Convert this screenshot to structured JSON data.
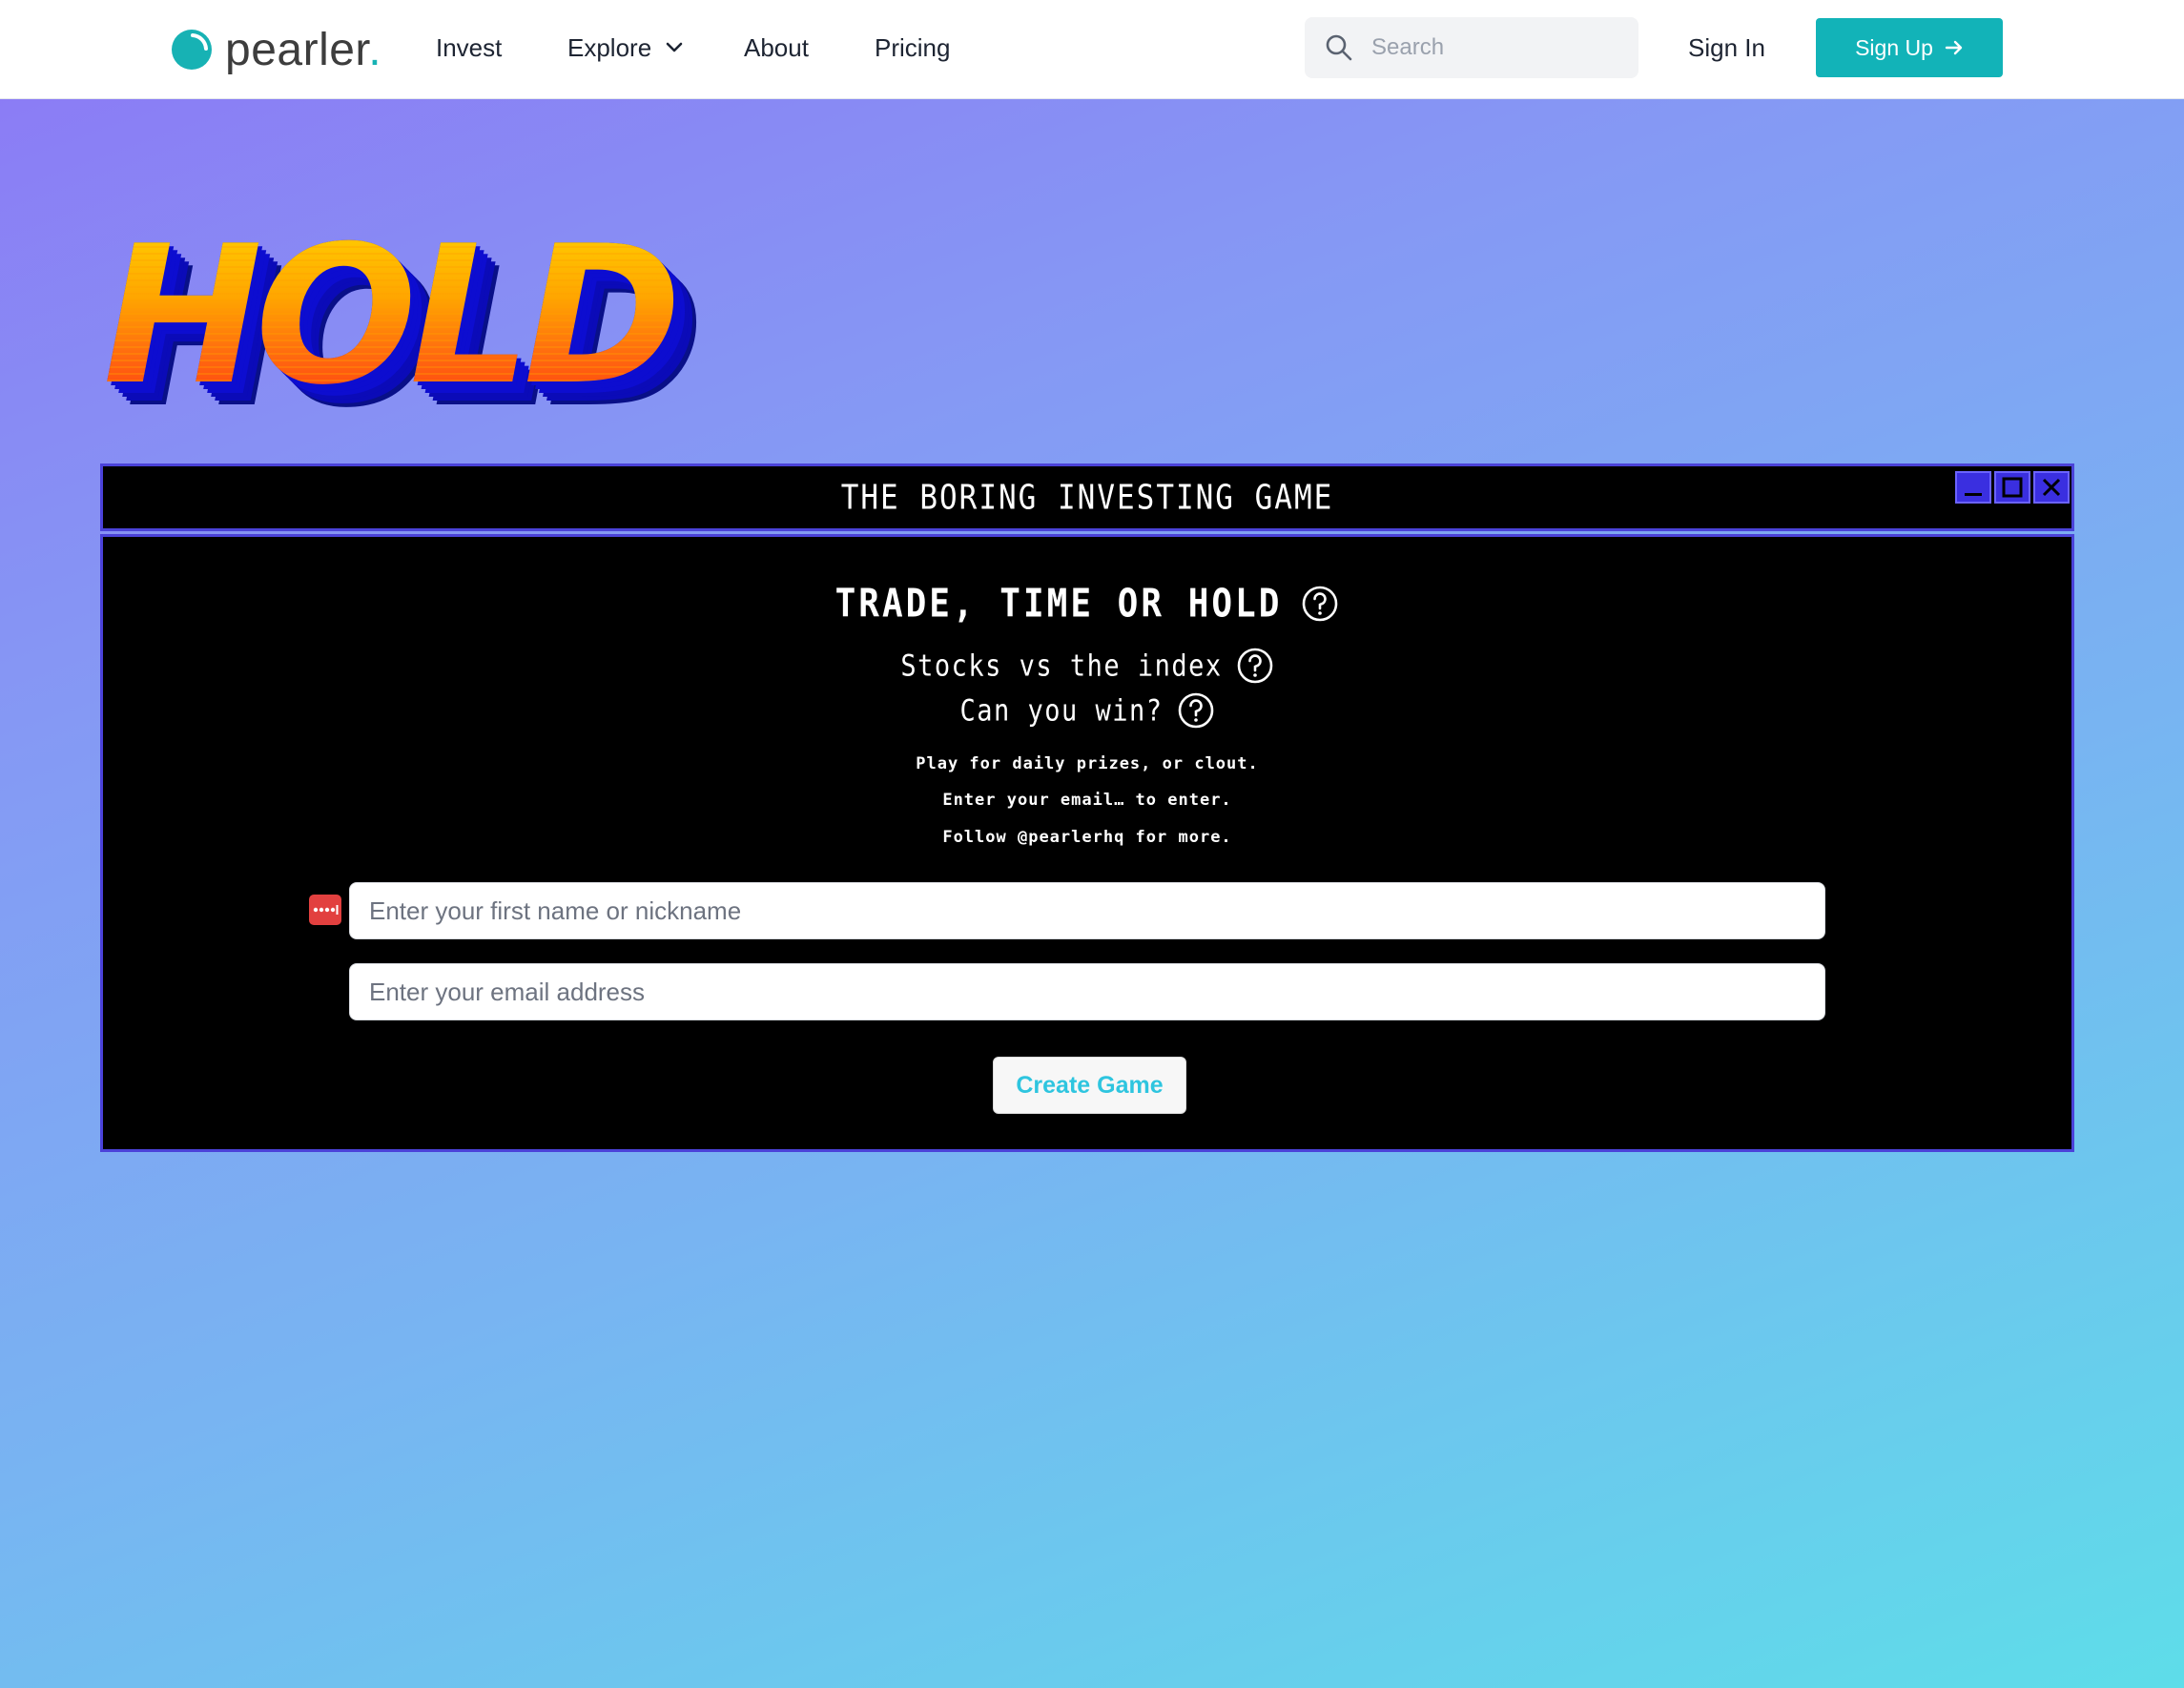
{
  "navbar": {
    "logo_text": "pearler",
    "logo_dot": ".",
    "links": {
      "invest": "Invest",
      "explore": "Explore",
      "about": "About",
      "pricing": "Pricing"
    },
    "search_placeholder": "Search",
    "sign_in": "Sign In",
    "sign_up": "Sign Up"
  },
  "hero": {
    "logo_word": "HOLD"
  },
  "game_window": {
    "title": "THE BORING INVESTING GAME",
    "headline": "TRADE, TIME OR HOLD",
    "subtitle_1": "Stocks vs the index",
    "subtitle_2": "Can you win?",
    "info_lines": [
      "Play for daily prizes, or clout.",
      "Enter your email… to enter.",
      "Follow @pearlerhq for more."
    ],
    "name_placeholder": "Enter your first name or nickname",
    "email_placeholder": "Enter your email address",
    "create_button": "Create Game"
  },
  "colors": {
    "brand_teal": "#12b3b8",
    "window_border": "#4b42d9",
    "create_text": "#2ec5df"
  }
}
